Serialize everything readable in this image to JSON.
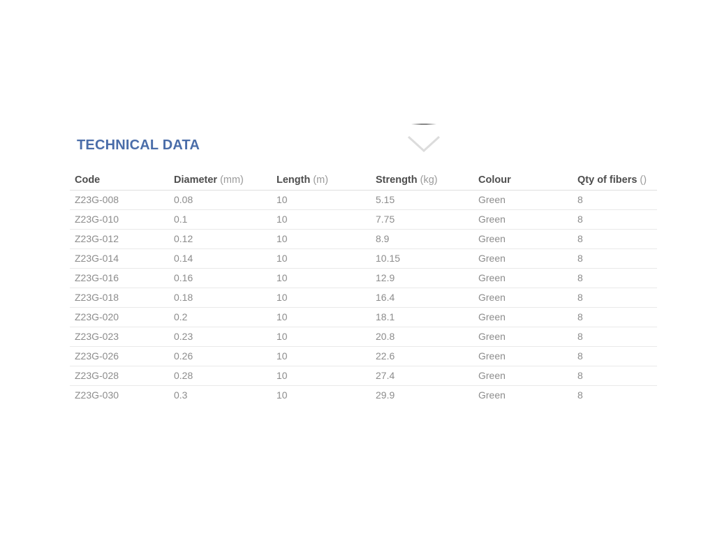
{
  "section": {
    "title": "TECHNICAL DATA",
    "title_color": "#4a6da9"
  },
  "collapse_indicator": {
    "icon": "chevron-down-icon",
    "chevron_color": "#dcdcdc",
    "line_color": "#737373"
  },
  "table": {
    "columns": [
      {
        "label": "Code",
        "unit": ""
      },
      {
        "label": "Diameter",
        "unit": "(mm)"
      },
      {
        "label": "Length",
        "unit": "(m)"
      },
      {
        "label": "Strength",
        "unit": "(kg)"
      },
      {
        "label": "Colour",
        "unit": ""
      },
      {
        "label": "Qty of fibers",
        "unit": "()"
      }
    ],
    "rows": [
      [
        "Z23G-008",
        "0.08",
        "10",
        "5.15",
        "Green",
        "8"
      ],
      [
        "Z23G-010",
        "0.1",
        "10",
        "7.75",
        "Green",
        "8"
      ],
      [
        "Z23G-012",
        "0.12",
        "10",
        "8.9",
        "Green",
        "8"
      ],
      [
        "Z23G-014",
        "0.14",
        "10",
        "10.15",
        "Green",
        "8"
      ],
      [
        "Z23G-016",
        "0.16",
        "10",
        "12.9",
        "Green",
        "8"
      ],
      [
        "Z23G-018",
        "0.18",
        "10",
        "16.4",
        "Green",
        "8"
      ],
      [
        "Z23G-020",
        "0.2",
        "10",
        "18.1",
        "Green",
        "8"
      ],
      [
        "Z23G-023",
        "0.23",
        "10",
        "20.8",
        "Green",
        "8"
      ],
      [
        "Z23G-026",
        "0.26",
        "10",
        "22.6",
        "Green",
        "8"
      ],
      [
        "Z23G-028",
        "0.28",
        "10",
        "27.4",
        "Green",
        "8"
      ],
      [
        "Z23G-030",
        "0.3",
        "10",
        "29.9",
        "Green",
        "8"
      ]
    ]
  }
}
